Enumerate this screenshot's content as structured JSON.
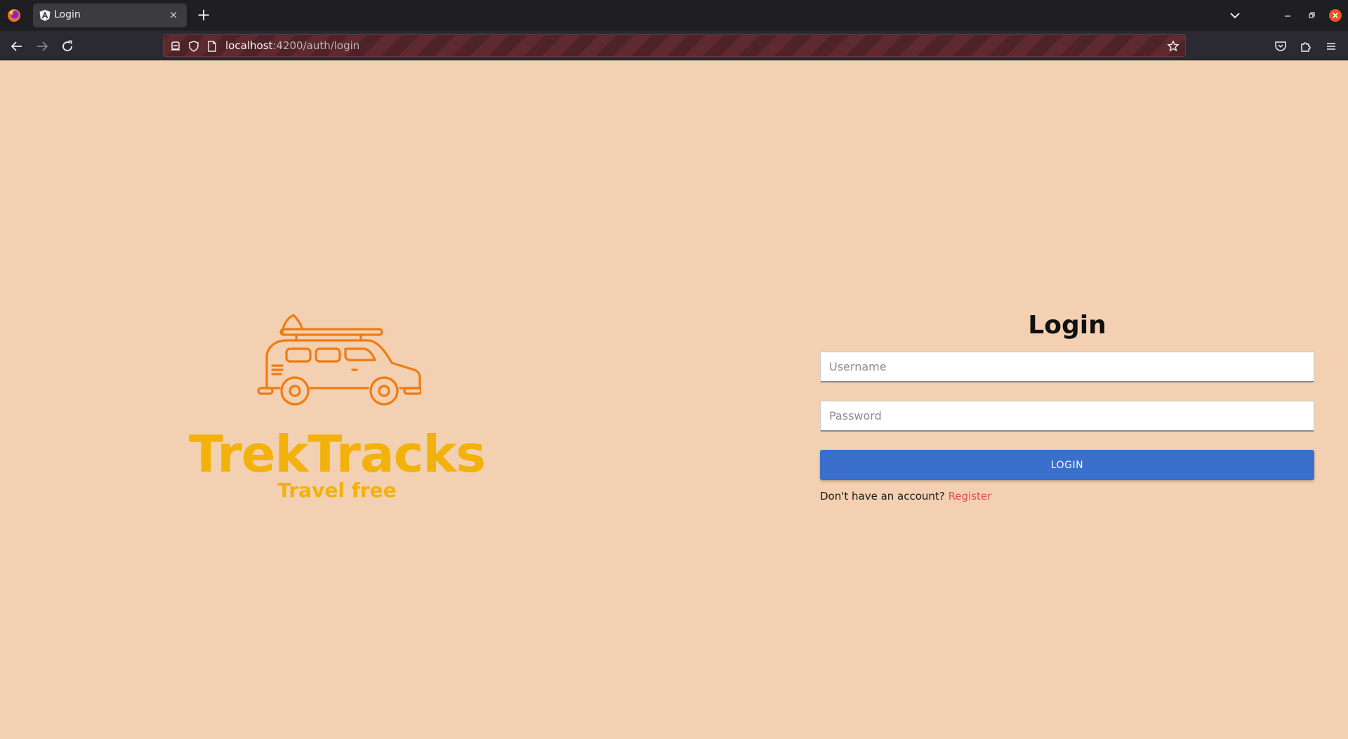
{
  "browser": {
    "tab": {
      "title": "Login",
      "close_glyph": "×"
    },
    "new_tab_glyph": "+",
    "url": {
      "host": "localhost",
      "path": ":4200/auth/login"
    },
    "icons": {
      "logo": "firefox-logo-icon",
      "tab_favicon": "angular-icon",
      "back": "arrow-left-icon",
      "forward": "arrow-right-icon",
      "reload": "reload-icon",
      "tracking": "tracking-protection-icon",
      "shield": "shield-icon",
      "page": "page-icon",
      "bookmark": "star-icon",
      "pocket": "pocket-icon",
      "extensions": "puzzle-icon",
      "menu": "hamburger-menu-icon"
    }
  },
  "brand": {
    "name": "TrekTracks",
    "tagline": "Travel free",
    "logo_icon": "van-icon",
    "colors": {
      "name": "#f2b10b",
      "logo": "#f07b12"
    }
  },
  "login": {
    "title": "Login",
    "username_placeholder": "Username",
    "password_placeholder": "Password",
    "submit_label": "LOGIN",
    "register_prompt": "Don't have an account?",
    "register_link": "Register"
  },
  "colors": {
    "page_bg": "#f2d0b1",
    "button_bg": "#3a70cb",
    "link": "#df4d57"
  }
}
